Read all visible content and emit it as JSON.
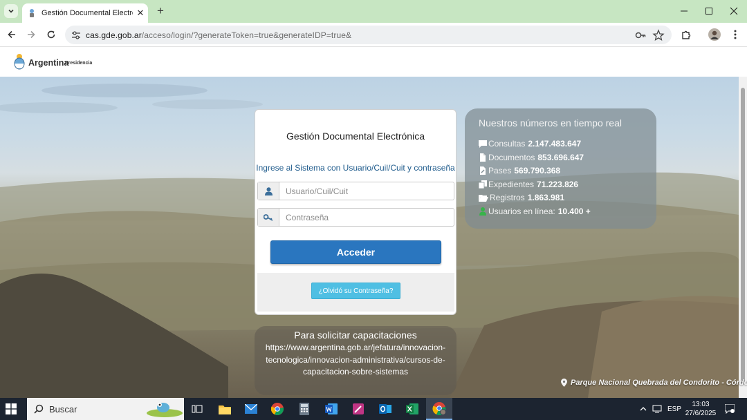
{
  "browser": {
    "tab_title": "Gestión Documental Electrónica",
    "url_host": "cas.gde.gob.ar",
    "url_path": "/acceso/login/?generateToken=true&generateIDP=true&"
  },
  "header": {
    "logo_text": "Argentina",
    "logo_sub": "Presidencia"
  },
  "login": {
    "title": "Gestión Documental Electrónica",
    "subtitle": "Ingrese al Sistema con Usuario/Cuil/Cuit y contraseña",
    "user_placeholder": "Usuario/Cuil/Cuit",
    "password_placeholder": "Contraseña",
    "submit_label": "Acceder",
    "forgot_label": "¿Olvidó su Contraseña?"
  },
  "stats": {
    "title": "Nuestros números en tiempo real",
    "items": [
      {
        "label": "Consultas",
        "value": "2.147.483.647",
        "icon": "comment-icon"
      },
      {
        "label": "Documentos",
        "value": "853.696.647",
        "icon": "document-icon"
      },
      {
        "label": "Pases",
        "value": "569.790.368",
        "icon": "pass-file-icon"
      },
      {
        "label": "Expedientes",
        "value": "71.223.826",
        "icon": "files-icon"
      },
      {
        "label": "Registros",
        "value": "1.863.981",
        "icon": "folder-open-icon"
      },
      {
        "label": "Usuarios en línea:",
        "value": "10.400 +",
        "icon": "user-icon"
      }
    ]
  },
  "capacitaciones": {
    "title": "Para solicitar capacitaciones",
    "link": "https://www.argentina.gob.ar/jefatura/innovacion-tecnologica/innovacion-administrativa/cursos-de-capacitacion-sobre-sistemas"
  },
  "location_caption": "Parque Nacional Quebrada del Condorito - Córdoba",
  "taskbar": {
    "search_label": "Buscar",
    "language": "ESP",
    "time": "13:03",
    "date": "27/6/2025"
  },
  "colors": {
    "tab_strip": "#c7e6c2",
    "primary_button": "#2a76bf",
    "secondary_button": "#4fbfe3",
    "subtitle_text": "#245f8f"
  }
}
